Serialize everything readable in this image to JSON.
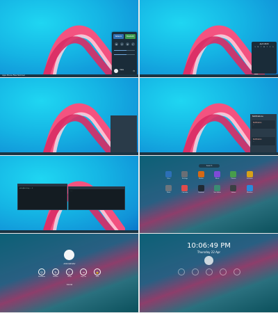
{
  "panel": {
    "left_items": "Apps  Places  Files  Terminal",
    "right_tray": ""
  },
  "quick_settings": {
    "tile_network": "Network",
    "tile_bluetooth": "Bluetooth",
    "user_name": "mike"
  },
  "calendar": {
    "header": "April 2020",
    "days": [
      "S",
      "M",
      "T",
      "W",
      "T",
      "F",
      "S"
    ]
  },
  "notifications": {
    "title": "Notifications",
    "cards": [
      {
        "title": "Notification",
        "body": "..."
      },
      {
        "title": "Notification",
        "body": "..."
      }
    ]
  },
  "terminal": {
    "lines": [
      "mike@desktop ~ $",
      "..."
    ]
  },
  "launcher": {
    "search_placeholder": "Search",
    "apps": [
      {
        "label": "Files",
        "color": "#2f6fb3"
      },
      {
        "label": "Settings",
        "color": "#6a6f75"
      },
      {
        "label": "Firefox",
        "color": "#d16a1a"
      },
      {
        "label": "Music",
        "color": "#7d4bd1"
      },
      {
        "label": "Photos",
        "color": "#4a9c4f"
      },
      {
        "label": "Software",
        "color": "#d5a21f"
      },
      {
        "label": "Disks",
        "color": "#6c757d"
      },
      {
        "label": "Calendar",
        "color": "#d94d4d"
      },
      {
        "label": "Terminal",
        "color": "#1f2a33"
      },
      {
        "label": "Text Editor",
        "color": "#3e8a73"
      },
      {
        "label": "Videos",
        "color": "#3a3f44"
      },
      {
        "label": "Weather",
        "color": "#2b8ad8"
      }
    ]
  },
  "lock": {
    "user": "Administrator",
    "actions": [
      "Shutdown",
      "Restart",
      "Sleep",
      "Log Out",
      "Lock"
    ],
    "cancel": "Cancel",
    "time": "10:06:49 PM",
    "date": "Thursday 22 Apr"
  }
}
